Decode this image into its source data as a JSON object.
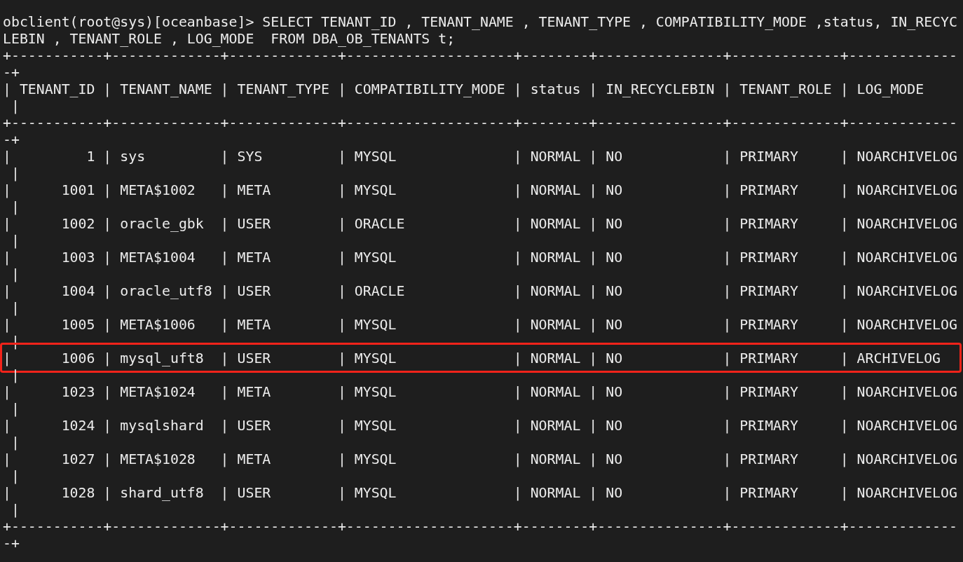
{
  "terminal": {
    "lines": [
      {
        "text": "obclient(root@sys)[oceanbase]> SELECT TENANT_ID , TENANT_NAME , TENANT_TYPE , COMPATIBILITY_MODE ,status, IN_RECYC",
        "highlighted": false
      },
      {
        "text": "LEBIN , TENANT_ROLE , LOG_MODE  FROM DBA_OB_TENANTS t;",
        "highlighted": false
      },
      {
        "text": "+-----------+-------------+-------------+--------------------+--------+---------------+-------------+-------------",
        "highlighted": false
      },
      {
        "text": "-+",
        "highlighted": false
      },
      {
        "text": "| TENANT_ID | TENANT_NAME | TENANT_TYPE | COMPATIBILITY_MODE | status | IN_RECYCLEBIN | TENANT_ROLE | LOG_MODE",
        "highlighted": false
      },
      {
        "text": " |",
        "highlighted": false
      },
      {
        "text": "+-----------+-------------+-------------+--------------------+--------+---------------+-------------+-------------",
        "highlighted": false
      },
      {
        "text": "-+",
        "highlighted": false
      },
      {
        "text": "|         1 | sys         | SYS         | MYSQL              | NORMAL | NO            | PRIMARY     | NOARCHIVELOG",
        "highlighted": false
      },
      {
        "text": " |",
        "highlighted": false
      },
      {
        "text": "|      1001 | META$1002   | META        | MYSQL              | NORMAL | NO            | PRIMARY     | NOARCHIVELOG",
        "highlighted": false
      },
      {
        "text": " |",
        "highlighted": false
      },
      {
        "text": "|      1002 | oracle_gbk  | USER        | ORACLE             | NORMAL | NO            | PRIMARY     | NOARCHIVELOG",
        "highlighted": false
      },
      {
        "text": " |",
        "highlighted": false
      },
      {
        "text": "|      1003 | META$1004   | META        | MYSQL              | NORMAL | NO            | PRIMARY     | NOARCHIVELOG",
        "highlighted": false
      },
      {
        "text": " |",
        "highlighted": false
      },
      {
        "text": "|      1004 | oracle_utf8 | USER        | ORACLE             | NORMAL | NO            | PRIMARY     | NOARCHIVELOG",
        "highlighted": false
      },
      {
        "text": " |",
        "highlighted": false
      },
      {
        "text": "|      1005 | META$1006   | META        | MYSQL              | NORMAL | NO            | PRIMARY     | NOARCHIVELOG",
        "highlighted": false
      },
      {
        "text": " |",
        "highlighted": false
      },
      {
        "text": "|      1006 | mysql_uft8  | USER        | MYSQL              | NORMAL | NO            | PRIMARY     | ARCHIVELOG",
        "highlighted": true
      },
      {
        "text": " |",
        "highlighted": false
      },
      {
        "text": "|      1023 | META$1024   | META        | MYSQL              | NORMAL | NO            | PRIMARY     | NOARCHIVELOG",
        "highlighted": false
      },
      {
        "text": " |",
        "highlighted": false
      },
      {
        "text": "|      1024 | mysqlshard  | USER        | MYSQL              | NORMAL | NO            | PRIMARY     | NOARCHIVELOG",
        "highlighted": false
      },
      {
        "text": " |",
        "highlighted": false
      },
      {
        "text": "|      1027 | META$1028   | META        | MYSQL              | NORMAL | NO            | PRIMARY     | NOARCHIVELOG",
        "highlighted": false
      },
      {
        "text": " |",
        "highlighted": false
      },
      {
        "text": "|      1028 | shard_utf8  | USER        | MYSQL              | NORMAL | NO            | PRIMARY     | NOARCHIVELOG",
        "highlighted": false
      },
      {
        "text": " |",
        "highlighted": false
      },
      {
        "text": "+-----------+-------------+-------------+--------------------+--------+---------------+-------------+-------------",
        "highlighted": false
      },
      {
        "text": "-+",
        "highlighted": false
      }
    ]
  }
}
